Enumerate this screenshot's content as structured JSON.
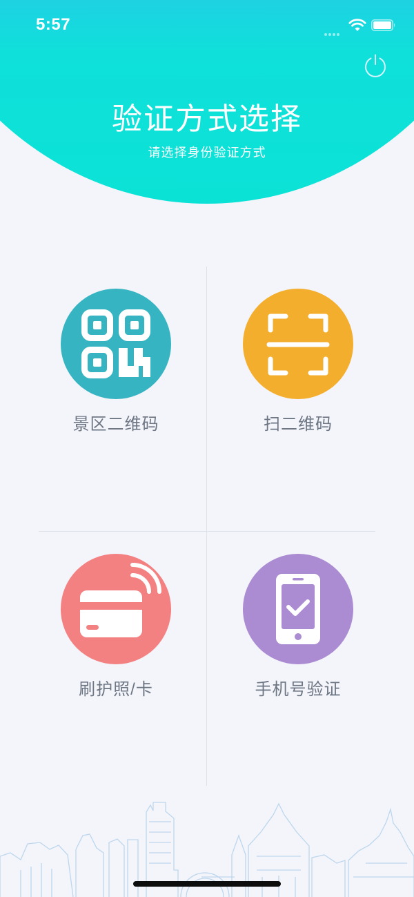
{
  "status_bar": {
    "time": "5:57"
  },
  "header": {
    "title": "验证方式选择",
    "subtitle": "请选择身份验证方式"
  },
  "options": [
    {
      "label": "景区二维码",
      "icon": "qr-code-icon",
      "color": "#37b4c2"
    },
    {
      "label": "扫二维码",
      "icon": "scan-icon",
      "color": "#f4ae2e"
    },
    {
      "label": "刷护照/卡",
      "icon": "nfc-card-icon",
      "color": "#f38182"
    },
    {
      "label": "手机号验证",
      "icon": "phone-check-icon",
      "color": "#ab8bd1"
    }
  ],
  "colors": {
    "header_top": "#3aa9f7",
    "header_bottom": "#0be2d6",
    "background": "#f3f5fa"
  }
}
